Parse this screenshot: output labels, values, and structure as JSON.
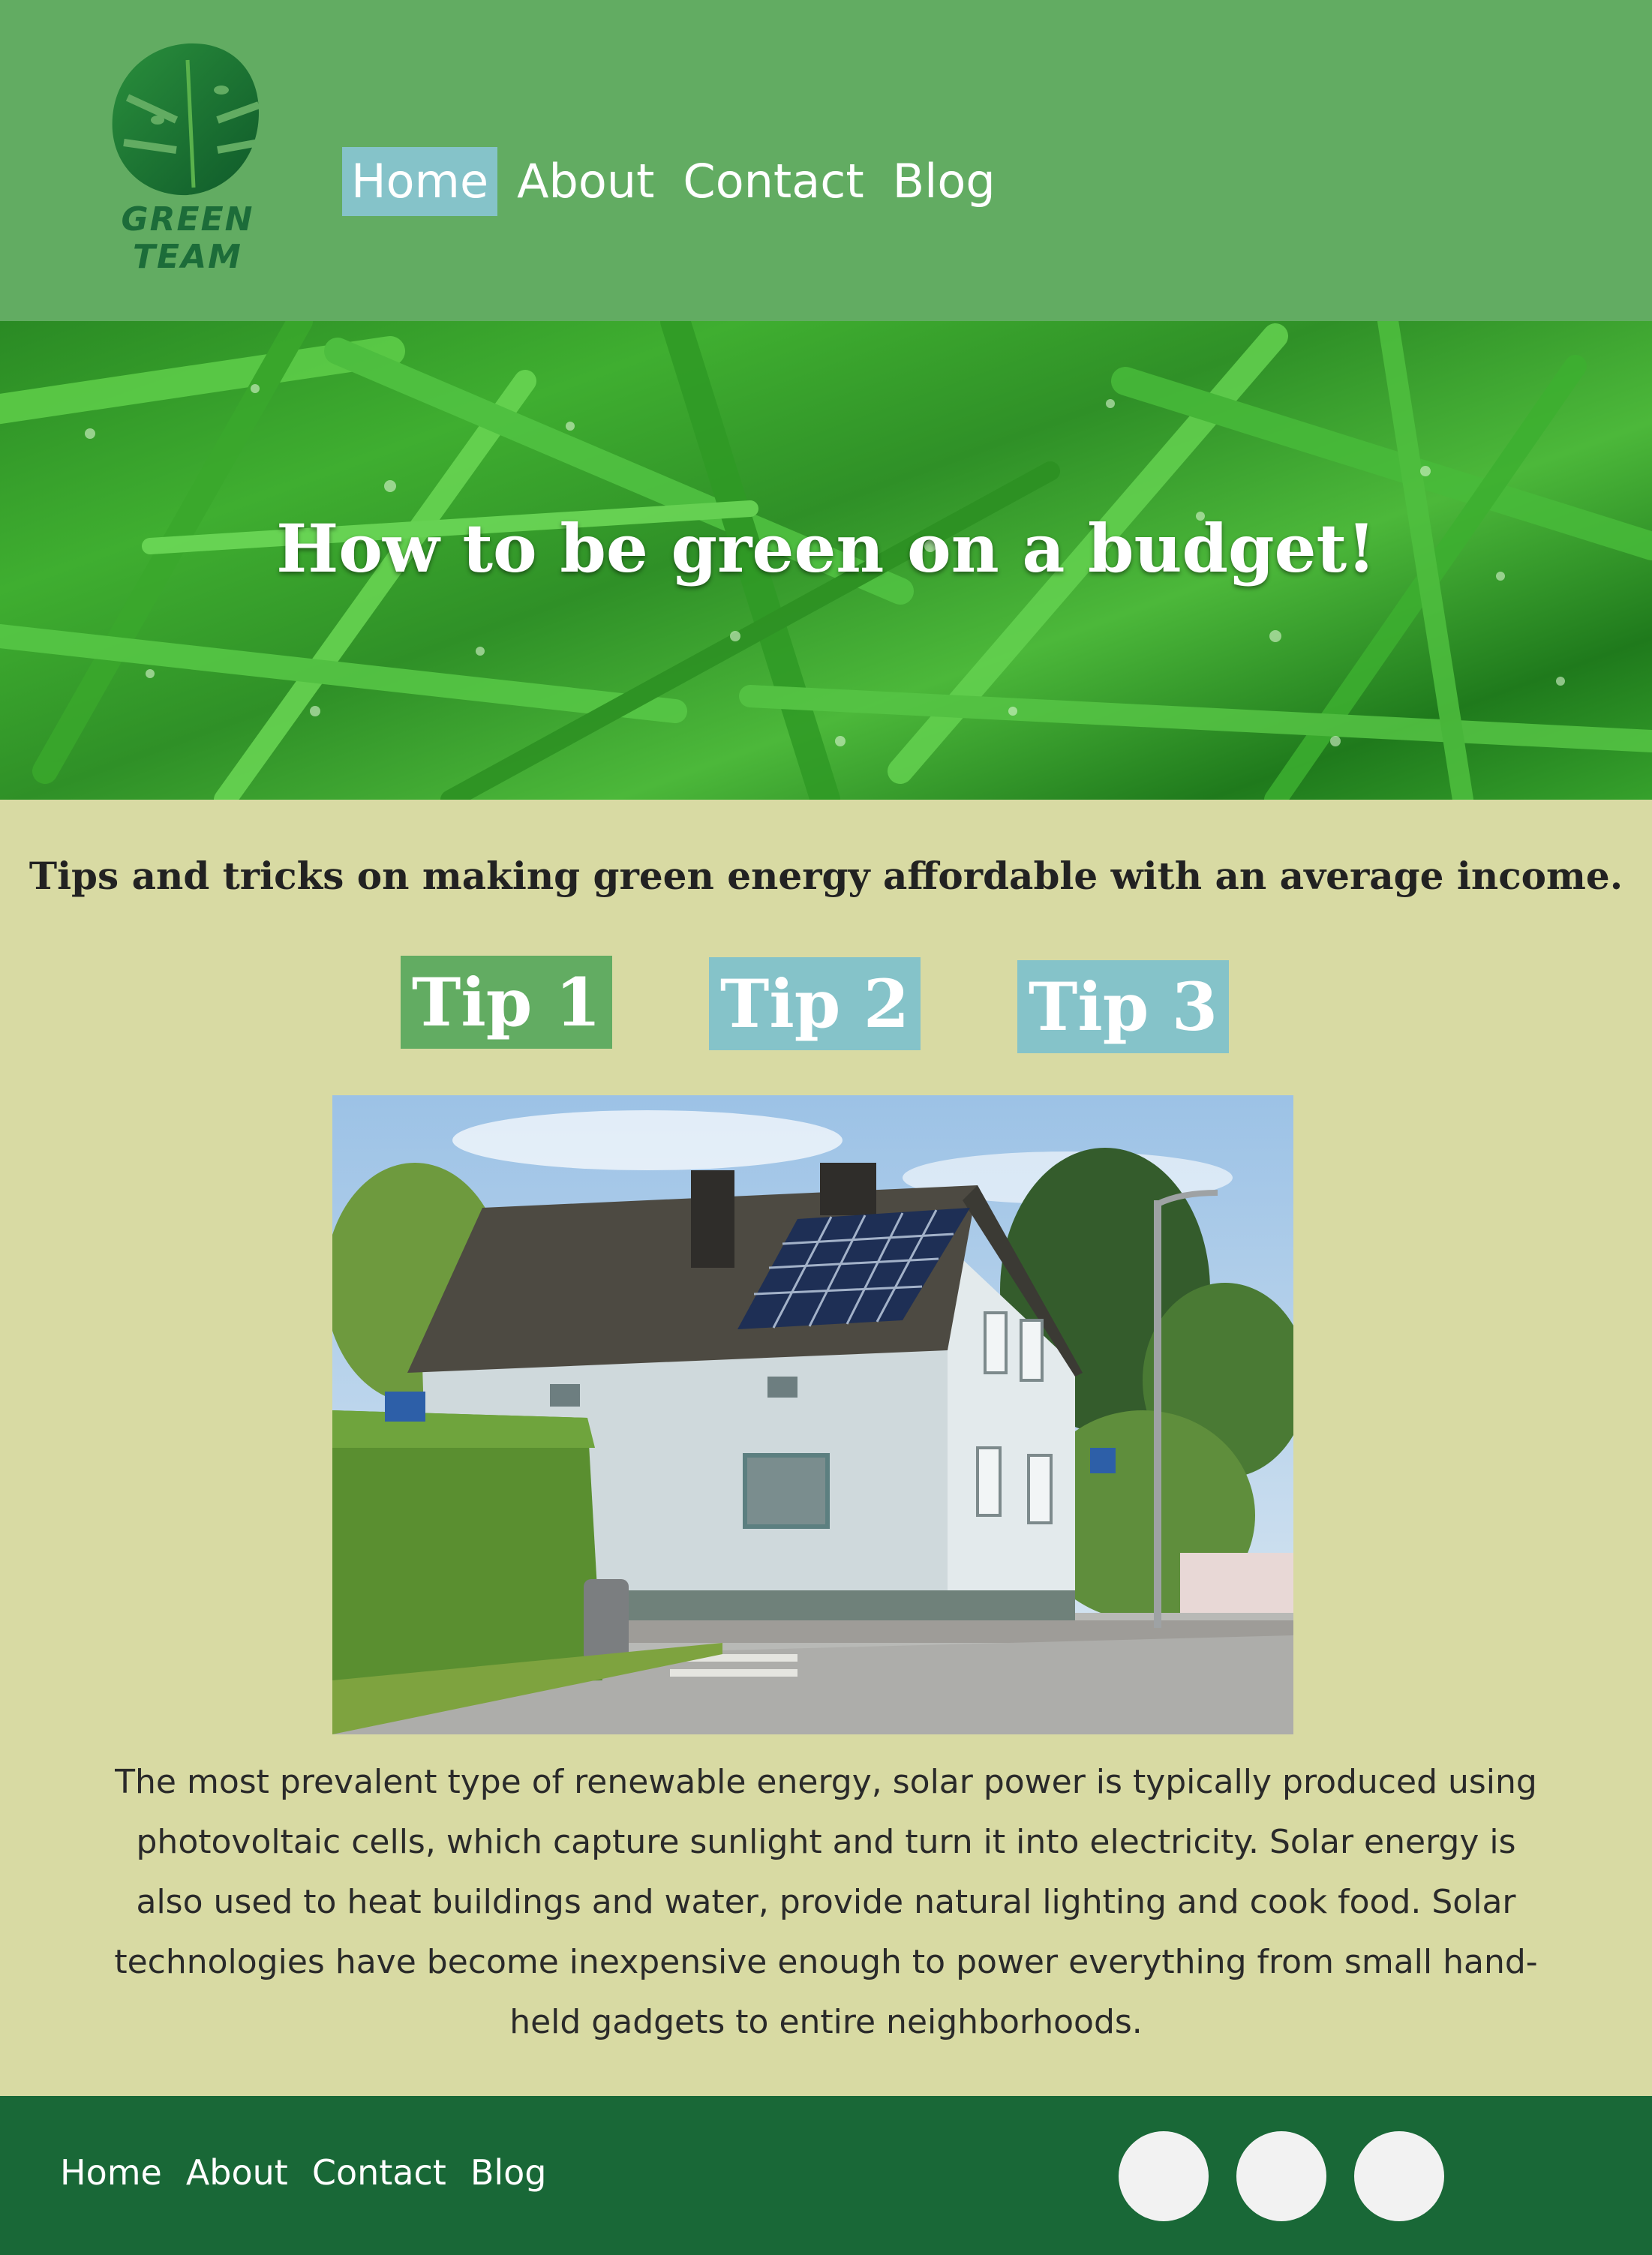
{
  "logo": {
    "line1": "GREEN",
    "line2": "TEAM"
  },
  "nav": {
    "items": [
      "Home",
      "About",
      "Contact",
      "Blog"
    ],
    "active": "Home"
  },
  "hero": {
    "title": "How to be green on a budget!"
  },
  "main": {
    "subtitle": "Tips and tricks on making green energy affordable with an average income.",
    "tips": [
      "Tip 1",
      "Tip 2",
      "Tip 3"
    ],
    "photo_icon": "house-with-solar-panels-photo",
    "body": "The most prevalent type of renewable energy, solar power is typically produced using photovoltaic cells, which capture sunlight and turn it into electricity. Solar energy is also used to heat buildings and water, provide natural lighting and cook food. Solar technologies have become inexpensive enough to power everything from small hand-held gadgets to entire neighborhoods."
  },
  "footer": {
    "nav": [
      "Home",
      "About",
      "Contact",
      "Blog"
    ],
    "social_icons": [
      "social-icon-1",
      "social-icon-2",
      "social-icon-3"
    ]
  },
  "colors": {
    "header_bg": "#62ac62",
    "nav_active_bg": "#85c3c9",
    "page_bg": "#d8daa3",
    "footer_bg": "#196837",
    "tip_active_bg": "#62ac62",
    "tip_inactive_bg": "#85c3c9"
  }
}
